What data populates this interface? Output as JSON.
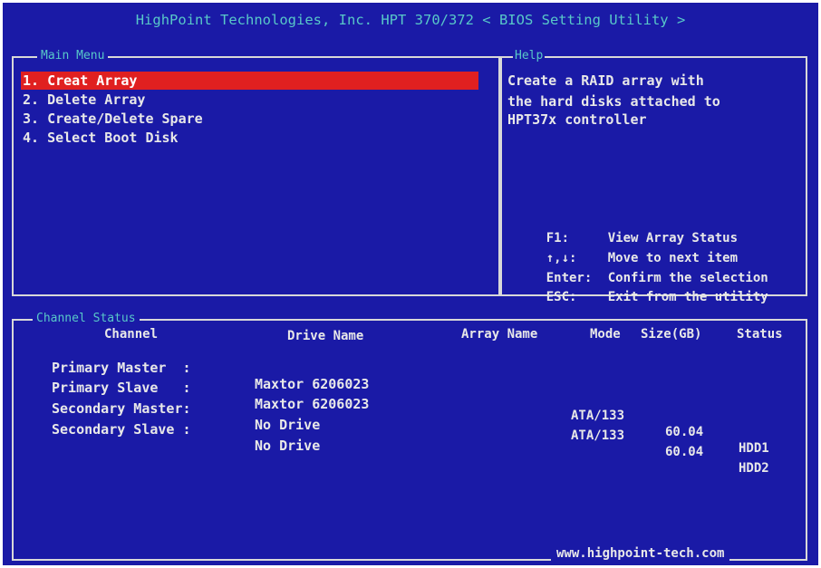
{
  "title": "HighPoint Technologies, Inc. HPT 370/372 < BIOS Setting Utility >",
  "main_menu": {
    "label": "Main Menu",
    "items": [
      {
        "label": "1. Creat Array",
        "selected": true
      },
      {
        "label": "2. Delete Array",
        "selected": false
      },
      {
        "label": "3. Create/Delete Spare",
        "selected": false
      },
      {
        "label": "4. Select Boot Disk",
        "selected": false
      }
    ]
  },
  "help": {
    "label": "Help",
    "lines": [
      "Create a RAID array with",
      "the hard disks attached to",
      "HPT37x controller"
    ],
    "keys": [
      {
        "key": "F1:",
        "desc": "View Array Status"
      },
      {
        "key": "↑,↓:",
        "desc": "Move to next item"
      },
      {
        "key": "Enter:",
        "desc": "Confirm the selection"
      },
      {
        "key": "ESC:",
        "desc": "Exit from the utility"
      }
    ]
  },
  "channel_status": {
    "label": "Channel Status",
    "headers": {
      "channel": "Channel",
      "drive_name": "Drive Name",
      "array_name": "Array Name",
      "mode": "Mode",
      "size": "Size(GB)",
      "status": "Status"
    },
    "rows": [
      {
        "channel": "Primary Master  :",
        "drive": "Maxtor 6206023",
        "array": "",
        "mode": "ATA/133",
        "size": "60.04",
        "status": "HDD1"
      },
      {
        "channel": "Primary Slave   :",
        "drive": "Maxtor 6206023",
        "array": "",
        "mode": "ATA/133",
        "size": "60.04",
        "status": "HDD2"
      },
      {
        "channel": "Secondary Master:",
        "drive": "No Drive",
        "array": "",
        "mode": "",
        "size": "",
        "status": ""
      },
      {
        "channel": "Secondary Slave :",
        "drive": "No Drive",
        "array": "",
        "mode": "",
        "size": "",
        "status": ""
      }
    ]
  },
  "footer": "www.highpoint-tech.com",
  "colors": {
    "background": "#1a1aa6",
    "highlight": "#e02020",
    "title": "#58c8c8",
    "text": "#e8e8e8"
  }
}
